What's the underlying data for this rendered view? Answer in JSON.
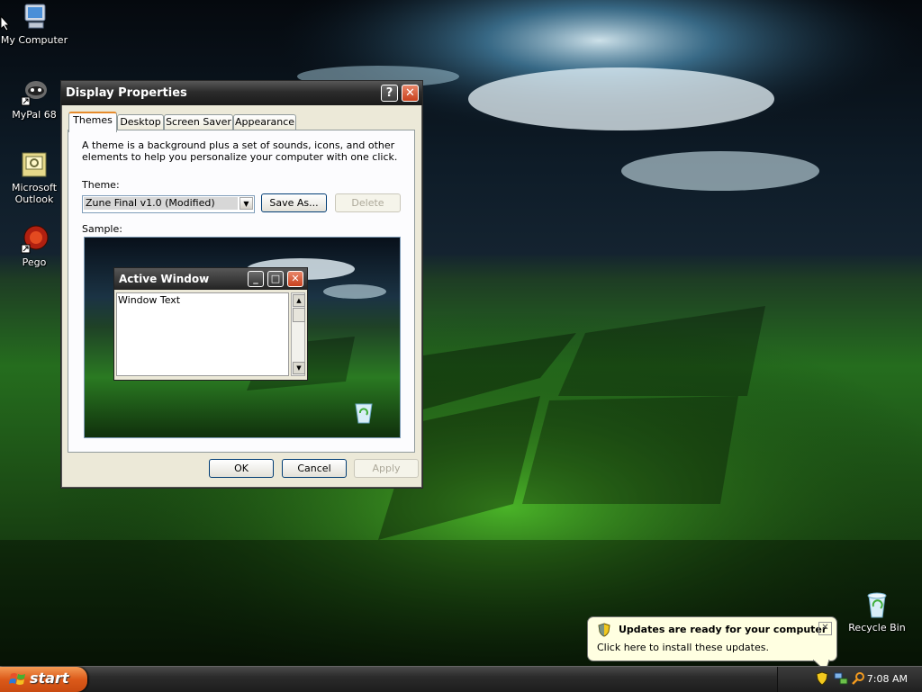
{
  "desktop": {
    "icons": [
      {
        "label": "My Computer"
      },
      {
        "label": "MyPal 68"
      },
      {
        "label": "Microsoft Outlook"
      },
      {
        "label": "Pego"
      },
      {
        "label": "Recycle Bin"
      }
    ]
  },
  "window": {
    "title": "Display Properties",
    "help_glyph": "?",
    "close_glyph": "✕",
    "tabs": [
      {
        "label": "Themes"
      },
      {
        "label": "Desktop"
      },
      {
        "label": "Screen Saver"
      },
      {
        "label": "Appearance"
      }
    ],
    "description": "A theme is a background plus a set of sounds, icons, and other elements to help you personalize your computer with one click.",
    "theme_label": "Theme:",
    "theme_value": "Zune Final v1.0 (Modified)",
    "save_as_label": "Save As...",
    "delete_label": "Delete",
    "sample_label": "Sample:",
    "sample_window": {
      "title": "Active Window",
      "text": "Window Text"
    },
    "ok_label": "OK",
    "cancel_label": "Cancel",
    "apply_label": "Apply"
  },
  "taskbar": {
    "start_label": "start",
    "clock": "7:08 AM"
  },
  "notification": {
    "title": "Updates are ready for your computer",
    "body": "Click here to install these updates."
  }
}
